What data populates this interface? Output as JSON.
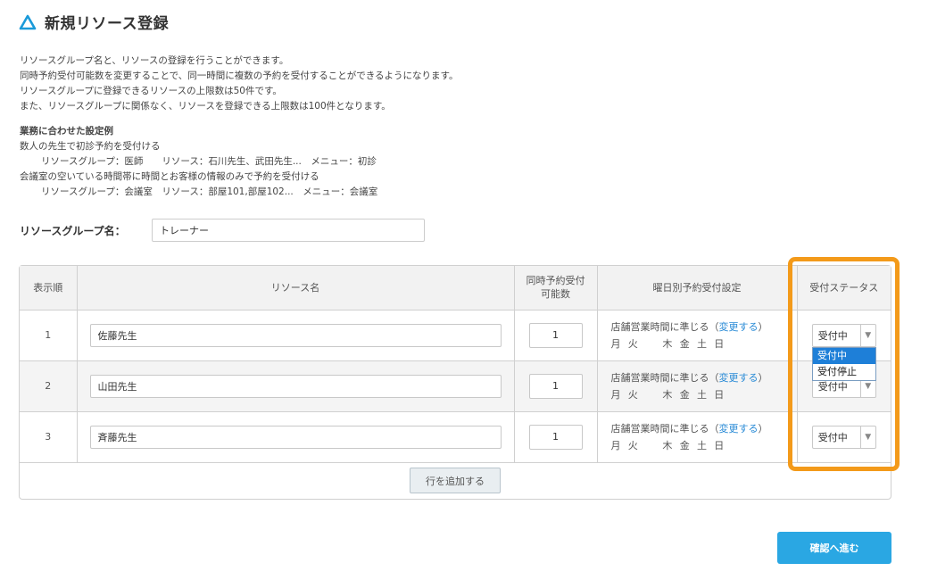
{
  "header": {
    "title": "新規リソース登録",
    "icon": "triangle-logo-icon",
    "accent": "#1a9ad9"
  },
  "intro": {
    "lines": [
      "リソースグループ名と、リソースの登録を行うことができます。",
      "同時予約受付可能数を変更することで、同一時間に複数の予約を受付することができるようになります。",
      "リソースグループに登録できるリソースの上限数は50件です。",
      "また、リソースグループに関係なく、リソースを登録できる上限数は100件となります。"
    ]
  },
  "example": {
    "heading": "業務に合わせた設定例",
    "lines": [
      "数人の先生で初診予約を受付ける",
      "リソースグループ：医師　　リソース：石川先生、武田先生...　メニュー：初診",
      "会議室の空いている時間帯に時間とお客様の情報のみで予約を受付ける",
      "リソースグループ：会議室　リソース：部屋101,部屋102...　メニュー：会議室"
    ]
  },
  "group": {
    "label": "リソースグループ名：",
    "value": "トレーナー"
  },
  "table": {
    "headers": {
      "order": "表示順",
      "name": "リソース名",
      "capacity_line1": "同時予約受付",
      "capacity_line2": "可能数",
      "weekday": "曜日別予約受付設定",
      "status": "受付ステータス"
    },
    "rows": [
      {
        "order": "1",
        "name": "佐藤先生",
        "capacity": "1",
        "rule": "店舗営業時間に準じる",
        "change_link": "変更する",
        "days": [
          "月",
          "火",
          "",
          "木",
          "金",
          "土",
          "日"
        ],
        "status": "受付中"
      },
      {
        "order": "2",
        "name": "山田先生",
        "capacity": "1",
        "rule": "店舗営業時間に準じる",
        "change_link": "変更する",
        "days": [
          "月",
          "火",
          "",
          "木",
          "金",
          "土",
          "日"
        ],
        "status": "受付中"
      },
      {
        "order": "3",
        "name": "斉藤先生",
        "capacity": "1",
        "rule": "店舗営業時間に準じる",
        "change_link": "変更する",
        "days": [
          "月",
          "火",
          "",
          "木",
          "金",
          "土",
          "日"
        ],
        "status": "受付中"
      }
    ],
    "add_row_label": "行を追加する"
  },
  "dropdown": {
    "options": [
      "受付中",
      "受付停止"
    ],
    "selected": "受付中"
  },
  "highlight_color": "#f39a1a",
  "confirm_label": "確認へ進む",
  "confirm_color": "#2aa7e3"
}
